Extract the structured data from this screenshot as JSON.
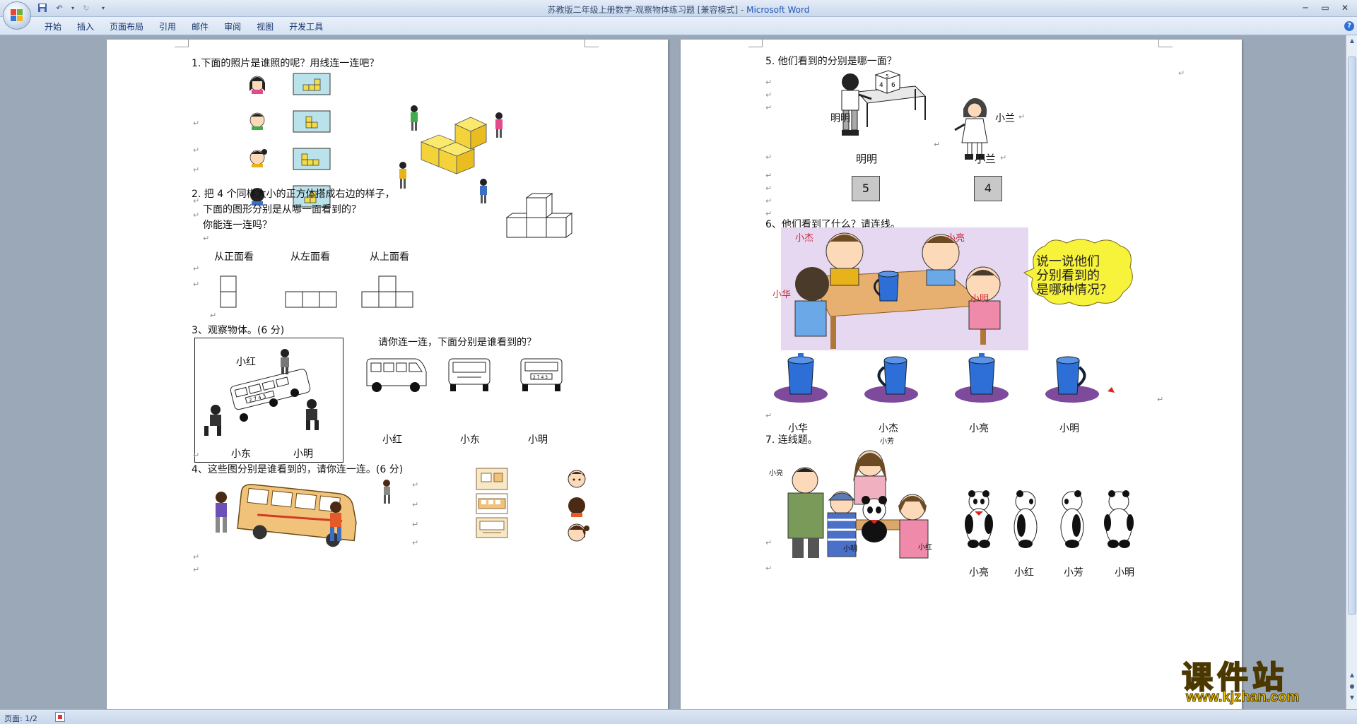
{
  "window": {
    "title_doc": "苏教版二年级上册数学-观察物体练习题 [兼容模式] - ",
    "title_app": "Microsoft Word"
  },
  "ribbon": {
    "tabs": [
      "开始",
      "插入",
      "页面布局",
      "引用",
      "邮件",
      "审阅",
      "视图",
      "开发工具"
    ]
  },
  "statusbar": {
    "page": "页面: 1/2"
  },
  "watermark": {
    "site_cn": "课件站",
    "site_url": "www.kjzhan.com"
  },
  "colors": {
    "accent": "#2156b8",
    "cube_yellow": "#f3dc4a",
    "mug_blue": "#2d6fd6",
    "mug_base": "#7d4a9c",
    "watermark": "#f5c800"
  },
  "page1": {
    "q1": {
      "text": "1.下面的照片是谁照的呢？用线连一连吧？"
    },
    "q2": {
      "line1": "2. 把 4 个同样大小的正方体搭成右边的样子，",
      "line2": "下面的图形分别是从哪一面看到的？",
      "line3": "你能连一连吗？",
      "views": [
        "从正面看",
        "从左面看",
        "从上面看"
      ]
    },
    "q3": {
      "text": "3、观察物体。(6 分)",
      "instruction": "请你连一连，下面分别是谁看到的？",
      "scene_labels": [
        "小红",
        "小东",
        "小明"
      ],
      "answer_labels": [
        "小红",
        "小东",
        "小明"
      ],
      "plate": "2 7 4 3"
    },
    "q4": {
      "text": "4、这些图分别是谁看到的，请你连一连。(6 分)"
    }
  },
  "page2": {
    "q5": {
      "text": "5. 他们看到的分别是哪一面？",
      "scene_labels": [
        "明明",
        "小兰"
      ],
      "names": [
        "明明",
        "小兰"
      ],
      "faces": [
        "5",
        "4"
      ],
      "die_digits": [
        "5",
        "4",
        "6"
      ]
    },
    "q6": {
      "text": "6、他们看到了什么？请连线。",
      "scene_labels": [
        "小杰",
        "小亮",
        "小华",
        "小明"
      ],
      "bubble": [
        "说一说他们",
        "分别看到的",
        "是哪种情况？"
      ],
      "names": [
        "小华",
        "小杰",
        "小亮",
        "小明"
      ]
    },
    "q7": {
      "text": "7. 连线题。",
      "scene_labels": [
        "小芳",
        "小亮",
        "小明",
        "小红"
      ],
      "names": [
        "小亮",
        "小红",
        "小芳",
        "小明"
      ]
    }
  }
}
